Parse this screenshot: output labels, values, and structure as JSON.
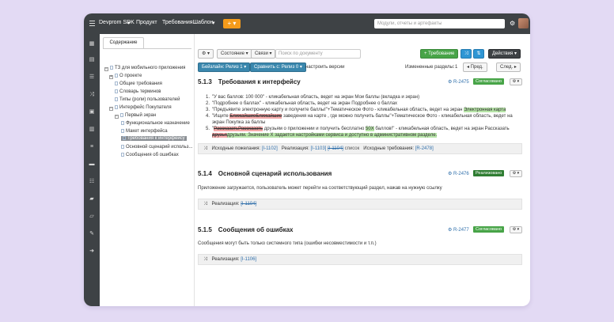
{
  "topbar": {
    "app_title": "Devprom SDK",
    "menu_product": "Продукт",
    "menu_requirements": "ТребованияШаблон",
    "plus_label": "+",
    "search_placeholder": "Модули, отчеты и артефакты"
  },
  "tree": {
    "tab_label": "Содержание",
    "nodes": [
      {
        "label": "ТЗ для мобильного приложения",
        "toggle": "−"
      },
      {
        "label": "О проекте",
        "toggle": "+"
      },
      {
        "label": "Общие требования"
      },
      {
        "label": "Словарь терминов"
      },
      {
        "label": "Типы (роли) пользователей"
      },
      {
        "label": "Интерфейс Покупателя",
        "toggle": "−"
      },
      {
        "label": "Первый экран",
        "toggle": "−"
      },
      {
        "label": "Функциональное назначение"
      },
      {
        "label": "Макет интерфейса"
      },
      {
        "label": "Требования к интерфейсу"
      },
      {
        "label": "Основной сценарий использ..."
      },
      {
        "label": "Сообщения об ошибках"
      }
    ]
  },
  "toolbar": {
    "gear_label": "⚙ ▾",
    "state_label": "Состояние ▾",
    "links_label": "Связи ▾",
    "doc_search_placeholder": "Поиск по документу",
    "new_req_label": "+ Требование",
    "actions_label": "Действия ▾",
    "baseline_label": "Бейзлайн: Релиз 1 ▾",
    "compare_label": "Сравнить с: Релиз 0 ▾",
    "configure_versions": "настроить версии",
    "changed_sections_label": "Измененные разделы:",
    "changed_sections_count": "1",
    "prev_label": "◂ Пред.",
    "next_label": "След. ▸"
  },
  "sections": [
    {
      "num": "5.1.3",
      "title": "Требования к интерфейсу",
      "ref": "R-2475",
      "status": "Согласовано",
      "list": [
        {
          "n": "1.",
          "text": "\"У вас баллов: 100 000\" - кликабельная область, ведет на экран Мои баллы (вкладка и экран)"
        },
        {
          "n": "2.",
          "text": "\"Подробнее о баллах\" - кликабельная область, ведет на экран Подробнее о баллах"
        },
        {
          "n": "3.",
          "pre": "\"Предъявите электронную карту и получите баллы!\"+Тематическое Фото - кликабельная область, ведет на экран ",
          "hl": "Электронная карта",
          "post": ""
        },
        {
          "n": "4.",
          "pre": "\"Ищите ",
          "del": "БлижайшиеБлижайшие",
          "post": " заведения на карте , где можно получить баллы\"+Тематическое Фото - кликабельная область, ведет на"
        },
        {
          "n": "",
          "text": "экран Покупка за баллы"
        },
        {
          "n": "5.",
          "pre": "\"",
          "del": "РассказатьРассказать",
          "post": " друзьям о приложении и получить бесплатно ",
          "hl2": "50X",
          "post2": " баллов!\" - кликабельная область, ведет на экран Рассказать"
        },
        {
          "n": "",
          "del": "друзья",
          "hl": "друзьям. Значение X задается настройками сервиса и доступно в административном разделе."
        }
      ],
      "trace": {
        "src_label": "Исходные пожелания:",
        "src_ref": "[I-1102]",
        "impl_label": "Реализация:",
        "impl_ref1": "[I-1103]",
        "impl_ref2": "[I-1104]",
        "list_label": "список",
        "req_label": "Исходные требования:",
        "req_ref": "[R-2478]"
      }
    },
    {
      "num": "5.1.4",
      "title": "Основной сценарий использования",
      "ref": "R-2476",
      "status": "Реализовано",
      "text": "Приложение загружается, пользователь может перейти на соответствующий раздел, нажав на нужную ссылку",
      "trace": {
        "impl_label": "Реализация:",
        "impl_ref": "[I-1104]"
      }
    },
    {
      "num": "5.1.5",
      "title": "Сообщения об ошибках",
      "ref": "R-2477",
      "status": "Согласовано",
      "text": "Сообщения могут быть только системного типа (ошибки несовместимости и т.п.)",
      "trace": {
        "impl_label": "Реализация:",
        "impl_ref": "[I-1106]"
      }
    }
  ],
  "colors": {
    "accent_orange": "#f59b1b",
    "status_green": "#47a447",
    "dark_bar": "#3e4245"
  }
}
